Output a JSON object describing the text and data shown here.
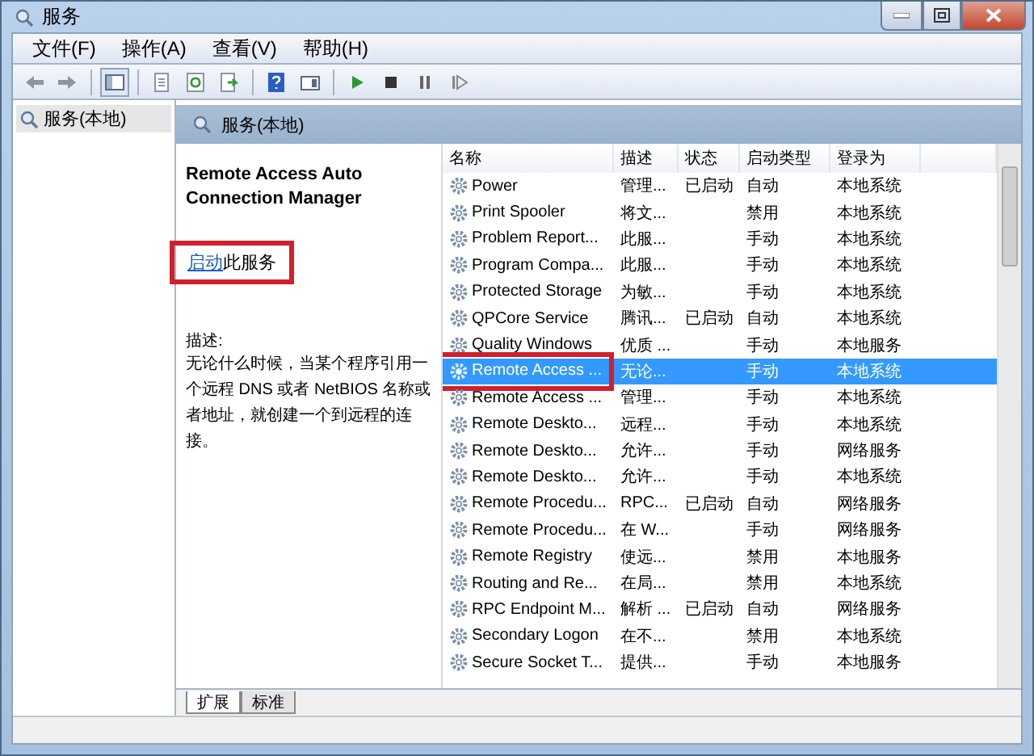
{
  "window": {
    "title": "服务"
  },
  "menu": [
    "文件(F)",
    "操作(A)",
    "查看(V)",
    "帮助(H)"
  ],
  "tree": {
    "items": [
      {
        "label": "服务(本地)",
        "selected": true
      }
    ]
  },
  "content": {
    "header": "服务(本地)"
  },
  "detail": {
    "title": "Remote Access Auto Connection Manager",
    "link": "启动",
    "link_suffix": "此服务",
    "highlighted": true,
    "description_label": "描述:",
    "description": "无论什么时候，当某个程序引用一个远程 DNS 或者 NetBIOS 名称或者地址，就创建一个到远程的连接。"
  },
  "table": {
    "columns": [
      "名称",
      "描述",
      "状态",
      "启动类型",
      "登录为"
    ],
    "rows": [
      {
        "name": "Power",
        "description": "管理...",
        "status": "已启动",
        "startup": "自动",
        "logon": "本地系统",
        "selected": false,
        "highlighted": false
      },
      {
        "name": "Print Spooler",
        "description": "将文...",
        "status": "",
        "startup": "禁用",
        "logon": "本地系统",
        "selected": false,
        "highlighted": false
      },
      {
        "name": "Problem Report...",
        "description": "此服...",
        "status": "",
        "startup": "手动",
        "logon": "本地系统",
        "selected": false,
        "highlighted": false
      },
      {
        "name": "Program Compa...",
        "description": "此服...",
        "status": "",
        "startup": "手动",
        "logon": "本地系统",
        "selected": false,
        "highlighted": false
      },
      {
        "name": "Protected Storage",
        "description": "为敏...",
        "status": "",
        "startup": "手动",
        "logon": "本地系统",
        "selected": false,
        "highlighted": false
      },
      {
        "name": "QPCore Service",
        "description": "腾讯...",
        "status": "已启动",
        "startup": "自动",
        "logon": "本地系统",
        "selected": false,
        "highlighted": false
      },
      {
        "name": "Quality Windows",
        "description": "优质 ...",
        "status": "",
        "startup": "手动",
        "logon": "本地服务",
        "selected": false,
        "highlighted": false
      },
      {
        "name": "Remote Access ...",
        "description": "无论...",
        "status": "",
        "startup": "手动",
        "logon": "本地系统",
        "selected": true,
        "highlighted": true
      },
      {
        "name": "Remote Access ...",
        "description": "管理...",
        "status": "",
        "startup": "手动",
        "logon": "本地系统",
        "selected": false,
        "highlighted": false
      },
      {
        "name": "Remote Deskto...",
        "description": "远程...",
        "status": "",
        "startup": "手动",
        "logon": "本地系统",
        "selected": false,
        "highlighted": false
      },
      {
        "name": "Remote Deskto...",
        "description": "允许...",
        "status": "",
        "startup": "手动",
        "logon": "网络服务",
        "selected": false,
        "highlighted": false
      },
      {
        "name": "Remote Deskto...",
        "description": "允许...",
        "status": "",
        "startup": "手动",
        "logon": "本地系统",
        "selected": false,
        "highlighted": false
      },
      {
        "name": "Remote Procedu...",
        "description": "RPC...",
        "status": "已启动",
        "startup": "自动",
        "logon": "网络服务",
        "selected": false,
        "highlighted": false
      },
      {
        "name": "Remote Procedu...",
        "description": "在 W...",
        "status": "",
        "startup": "手动",
        "logon": "网络服务",
        "selected": false,
        "highlighted": false
      },
      {
        "name": "Remote Registry",
        "description": "使远...",
        "status": "",
        "startup": "禁用",
        "logon": "本地服务",
        "selected": false,
        "highlighted": false
      },
      {
        "name": "Routing and Re...",
        "description": "在局...",
        "status": "",
        "startup": "禁用",
        "logon": "本地系统",
        "selected": false,
        "highlighted": false
      },
      {
        "name": "RPC Endpoint M...",
        "description": "解析 ...",
        "status": "已启动",
        "startup": "自动",
        "logon": "网络服务",
        "selected": false,
        "highlighted": false
      },
      {
        "name": "Secondary Logon",
        "description": "在不...",
        "status": "",
        "startup": "禁用",
        "logon": "本地系统",
        "selected": false,
        "highlighted": false
      },
      {
        "name": "Secure Socket T...",
        "description": "提供...",
        "status": "",
        "startup": "手动",
        "logon": "本地服务",
        "selected": false,
        "highlighted": false
      }
    ]
  },
  "tabs": [
    {
      "label": "扩展",
      "selected": true
    },
    {
      "label": "标准",
      "selected": false
    }
  ]
}
